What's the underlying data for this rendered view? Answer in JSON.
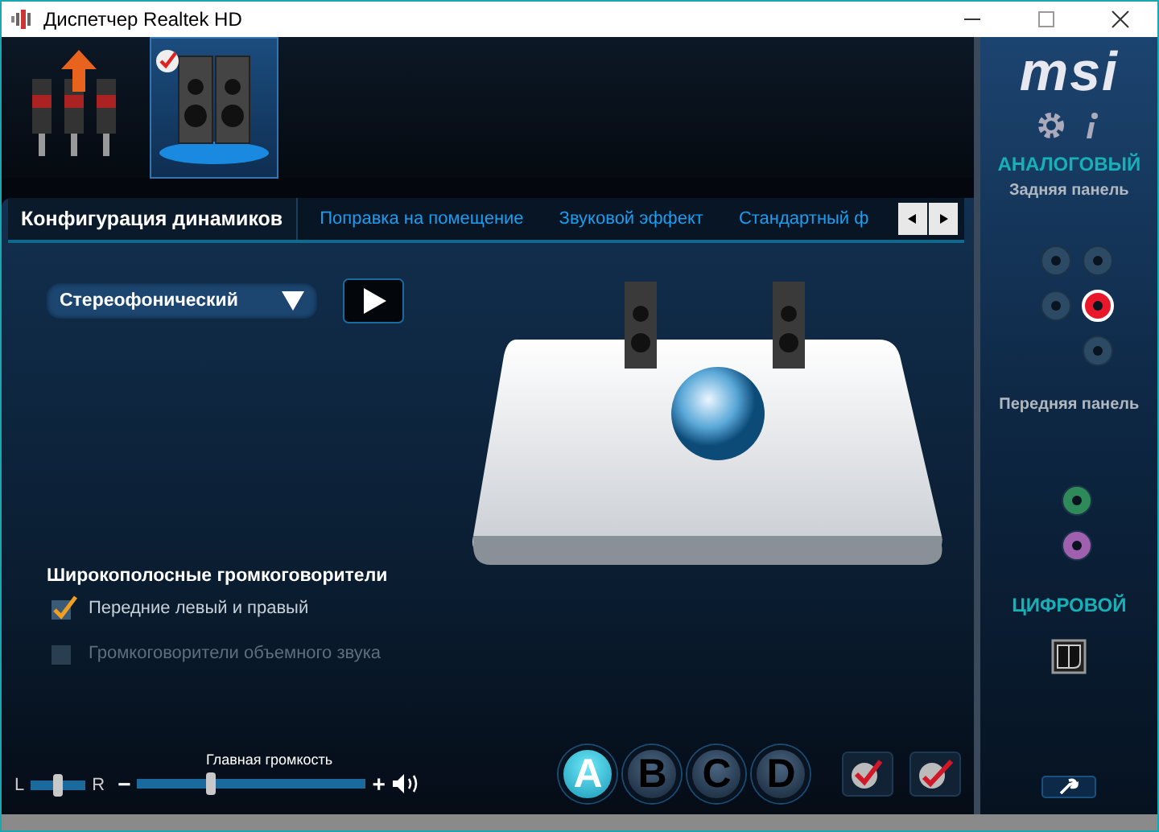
{
  "window": {
    "title": "Диспетчер Realtek HD"
  },
  "devices": [
    {
      "kind": "connectors",
      "selected": false
    },
    {
      "kind": "speakers",
      "selected": true
    }
  ],
  "logo": "msi",
  "tabs": [
    {
      "label": "Конфигурация динамиков",
      "selected": true
    },
    {
      "label": "Поправка на помещение",
      "selected": false
    },
    {
      "label": "Звуковой эффект",
      "selected": false
    },
    {
      "label": "Стандартный ф",
      "selected": false
    }
  ],
  "config": {
    "value": "Стереофонический"
  },
  "fullrange": {
    "title": "Широкополосные громкоговорители",
    "options": [
      {
        "label": "Передние левый и правый",
        "checked": true,
        "disabled": false
      },
      {
        "label": "Громкоговорители объемного звука",
        "checked": false,
        "disabled": true
      }
    ]
  },
  "balance": {
    "left": "L",
    "right": "R",
    "level": 0.5
  },
  "volume": {
    "label": "Главная громкость",
    "minus": "−",
    "plus": "+",
    "level": 0.32
  },
  "profiles": [
    {
      "label": "A",
      "selected": true
    },
    {
      "label": "B",
      "selected": false
    },
    {
      "label": "C",
      "selected": false
    },
    {
      "label": "D",
      "selected": false
    }
  ],
  "sidebar": {
    "analog": "АНАЛОГОВЫЙ",
    "rear": "Задняя панель",
    "rear_jacks": [
      {
        "color": "#2c4a63",
        "active": false
      },
      {
        "color": "#2c4a63",
        "active": false
      },
      {
        "color": "#2c4a63",
        "active": false
      },
      {
        "color": "#e8182a",
        "active": true
      },
      {
        "color": "#2c4a63",
        "active": false
      }
    ],
    "front": "Передняя панель",
    "front_jacks": [
      {
        "color": "#2f8a5a",
        "active": false
      },
      {
        "color": "#a060b0",
        "active": false
      }
    ],
    "digital": "ЦИФРОВОЙ"
  }
}
